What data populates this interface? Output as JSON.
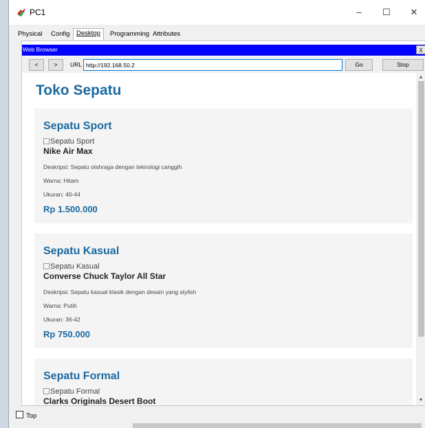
{
  "window": {
    "title": "PC1",
    "controls": {
      "minimize": "–",
      "maximize": "☐",
      "close": "✕"
    }
  },
  "tabs": [
    {
      "label": "Physical"
    },
    {
      "label": "Config"
    },
    {
      "label": "Desktop",
      "active": true
    },
    {
      "label": "Programming"
    },
    {
      "label": "Attributes"
    }
  ],
  "browser": {
    "title": "Web Browser",
    "close_label": "X",
    "back_label": "<",
    "forward_label": ">",
    "url_label": "URL",
    "url_value": "http://192.168.50.2",
    "go_label": "Go",
    "stop_label": "Stop",
    "accent_color": "#0000ff"
  },
  "page": {
    "title": "Toko Sepatu",
    "products": [
      {
        "category": "Sepatu Sport",
        "image_alt": "Sepatu Sport",
        "model": "Nike Air Max",
        "description": "Deskripsi: Sepatu olahraga dengan teknologi canggih",
        "color": "Warna: Hitam",
        "size": "Ukuran: 40-44",
        "price": "Rp 1.500.000"
      },
      {
        "category": "Sepatu Kasual",
        "image_alt": "Sepatu Kasual",
        "model": "Converse Chuck Taylor All Star",
        "description": "Deskripsi: Sepatu kasual klasik dengan desain yang stylish",
        "color": "Warna: Putih",
        "size": "Ukuran: 36-42",
        "price": "Rp 750.000"
      },
      {
        "category": "Sepatu Formal",
        "image_alt": "Sepatu Formal",
        "model": "Clarks Originals Desert Boot"
      }
    ]
  },
  "footer": {
    "top_checkbox_label": "Top",
    "top_checked": false
  },
  "icons": {
    "app": "packet-tracer-pc-icon",
    "scroll_up": "chevron-up-icon",
    "scroll_down": "chevron-down-icon"
  }
}
